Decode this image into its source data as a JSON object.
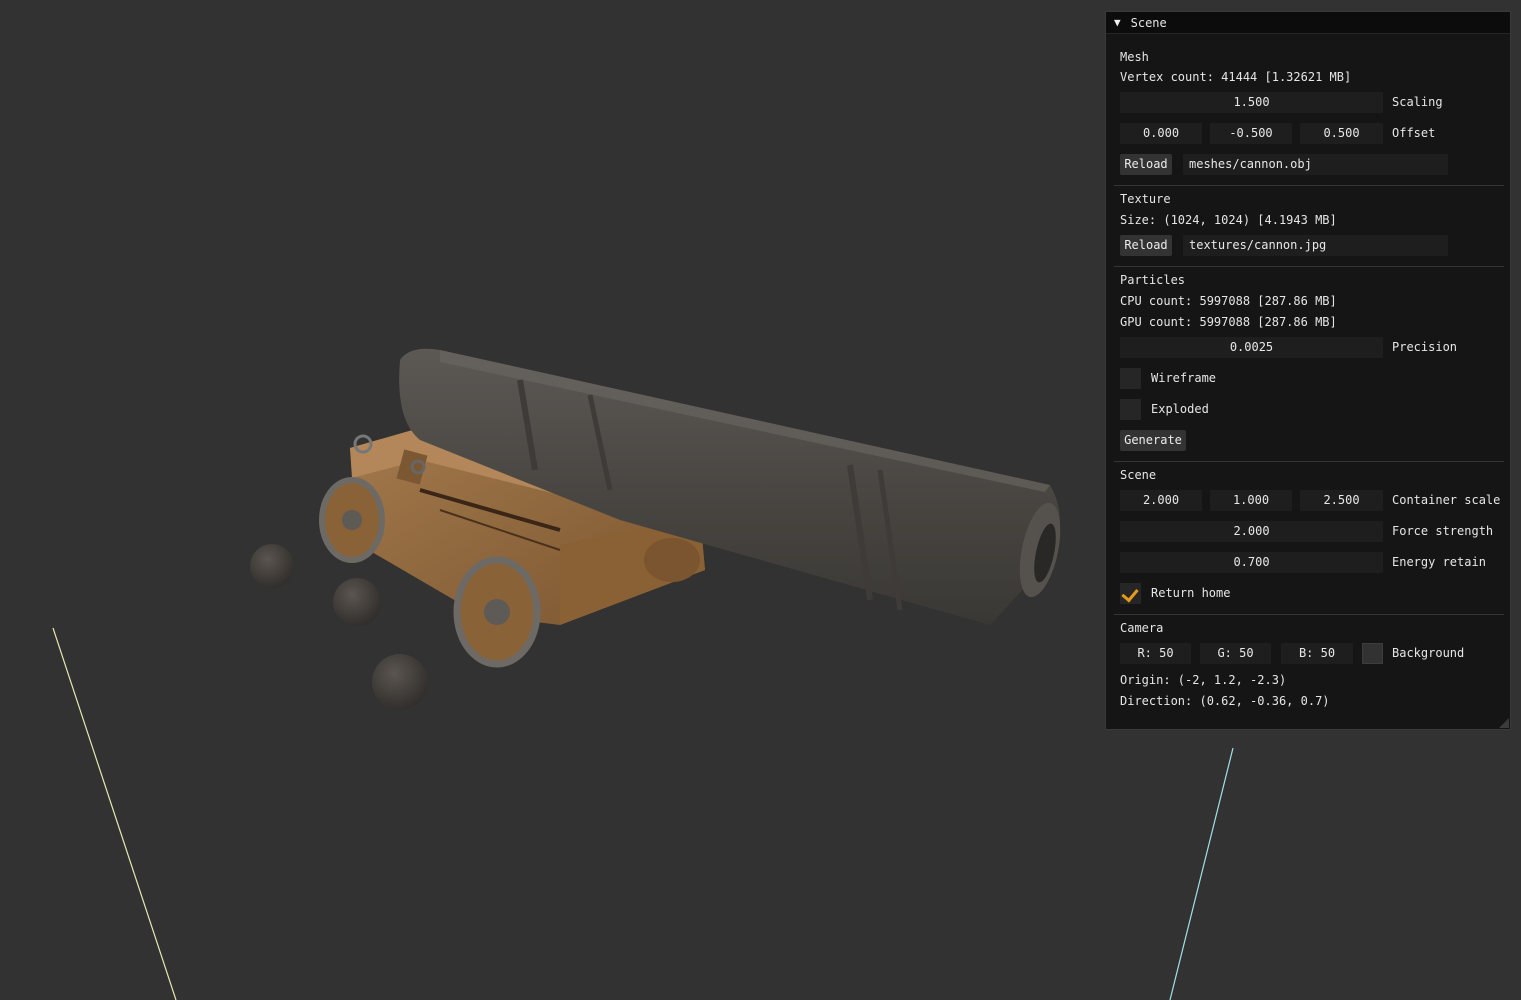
{
  "panel": {
    "title": "Scene",
    "mesh": {
      "heading": "Mesh",
      "vertex_count": "Vertex count: 41444 [1.32621 MB]",
      "scaling_value": "1.500",
      "scaling_label": "Scaling",
      "offset_x": "0.000",
      "offset_y": "-0.500",
      "offset_z": "0.500",
      "offset_label": "Offset",
      "reload_label": "Reload",
      "path": "meshes/cannon.obj"
    },
    "texture": {
      "heading": "Texture",
      "size": "Size: (1024, 1024) [4.1943 MB]",
      "reload_label": "Reload",
      "path": "textures/cannon.jpg"
    },
    "particles": {
      "heading": "Particles",
      "cpu_count": "CPU count: 5997088 [287.86 MB]",
      "gpu_count": "GPU count: 5997088 [287.86 MB]",
      "precision_value": "0.0025",
      "precision_label": "Precision",
      "wireframe_label": "Wireframe",
      "wireframe_checked": false,
      "exploded_label": "Exploded",
      "exploded_checked": false,
      "generate_label": "Generate"
    },
    "scene": {
      "heading": "Scene",
      "container_x": "2.000",
      "container_y": "1.000",
      "container_z": "2.500",
      "container_label": "Container scale",
      "force_value": "2.000",
      "force_label": "Force strength",
      "energy_value": "0.700",
      "energy_label": "Energy retain",
      "return_home_label": "Return home",
      "return_home_checked": true
    },
    "camera": {
      "heading": "Camera",
      "r": "R: 50",
      "g": "G: 50",
      "b": "B: 50",
      "background_label": "Background",
      "background_color": "#323232",
      "origin": "Origin: (-2, 1.2, -2.3)",
      "direction": "Direction: (0.62, -0.36, 0.7)"
    }
  },
  "colors": {
    "viewport_bg": "#323232",
    "accent": "#e89a1a"
  }
}
